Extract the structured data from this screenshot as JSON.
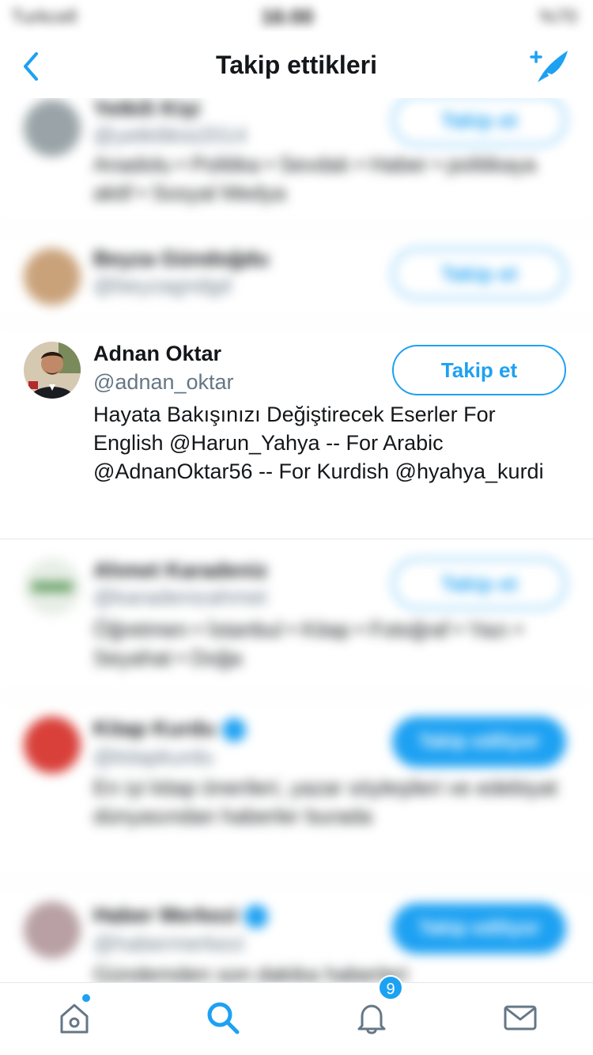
{
  "status_bar": {
    "carrier": "Turkcell",
    "time": "16:00",
    "battery": "%70"
  },
  "header": {
    "title": "Takip ettikleri"
  },
  "users": [
    {
      "name": "Yetkili Kişi",
      "handle": "@yetkilikisi2014",
      "bio": "Anadolu • Politika • Sevdalı • Haber • politikaya aktif • Sosyal Medya",
      "button": "Takip et",
      "following": false
    },
    {
      "name": "Beyza Gündoğdu",
      "handle": "@beyzagndgd",
      "bio": "",
      "button": "Takip et",
      "following": false
    },
    {
      "name": "Adnan Oktar",
      "handle": "@adnan_oktar",
      "bio": "Hayata Bakışınızı Değiştirecek Eserler For English @Harun_Yahya -- For Arabic @AdnanOktar56 -- For Kurdish @hyahya_kurdi",
      "button": "Takip et",
      "following": false
    },
    {
      "name": "Ahmet Karadeniz",
      "handle": "@karadenizahmet",
      "bio": "Öğretmen • İstanbul • Kitap • Fotoğraf • Yazı • Seyahat • Doğa",
      "button": "Takip et",
      "following": false
    },
    {
      "name": "Kitap Kurdu",
      "handle": "@kitapkurdu",
      "bio": "En iyi kitap önerileri, yazar söyleşileri ve edebiyat dünyasından haberler burada",
      "button": "Takip ediliyor",
      "following": true
    },
    {
      "name": "Haber Merkezi",
      "handle": "@habermerkezi",
      "bio": "Gündemden son dakika haberleri",
      "button": "Takip ediliyor",
      "following": true
    }
  ],
  "tabs": {
    "notifications_badge": "9"
  },
  "colors": {
    "accent": "#1da1f2",
    "text": "#14171a",
    "secondary": "#657786",
    "divider": "#e1e8ed"
  }
}
